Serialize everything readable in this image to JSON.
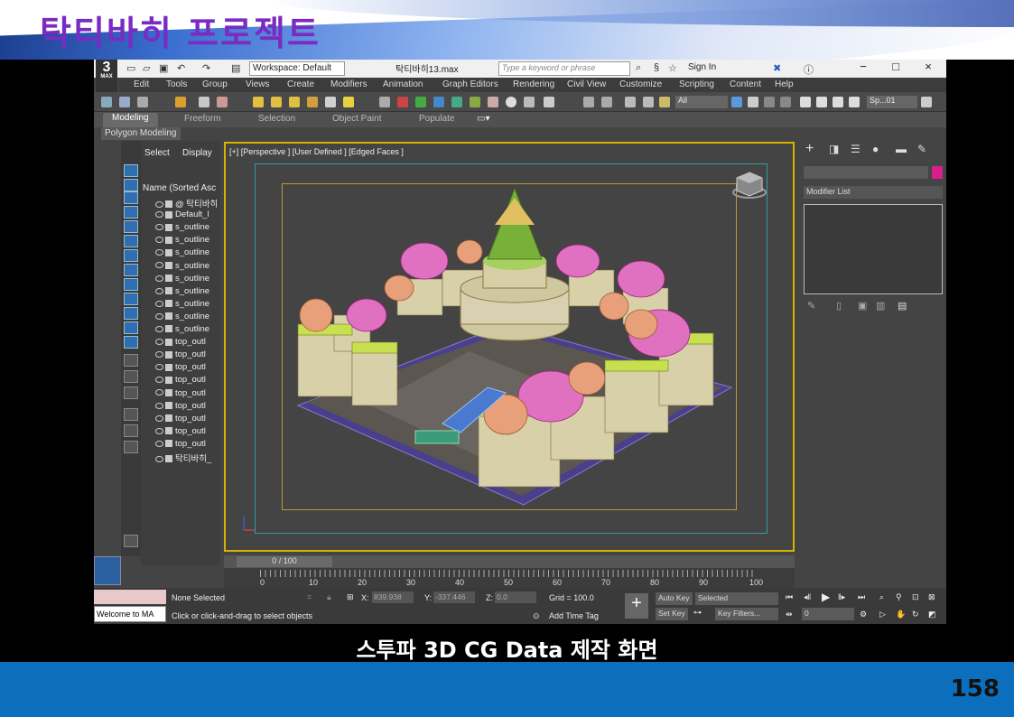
{
  "slide": {
    "title": "탁티바히 프로젝트",
    "caption": "스투파 3D CG Data 제작 화면",
    "page_number": "158"
  },
  "titlebar": {
    "logo_number": "3",
    "logo_sub": "MAX",
    "workspace": "Workspace: Default",
    "filename": "탁티바히13.max",
    "search_placeholder": "Type a keyword or phrase",
    "sign_in": "Sign In"
  },
  "menu": [
    "Edit",
    "Tools",
    "Group",
    "Views",
    "Create",
    "Modifiers",
    "Animation",
    "Graph Editors",
    "Rendering",
    "Civil View",
    "Customize",
    "Scripting",
    "Content",
    "Help"
  ],
  "toolbar": {
    "selection_filter": "All",
    "named_set": "Sp...01"
  },
  "ribbon": {
    "tabs": [
      "Modeling",
      "Freeform",
      "Selection",
      "Object Paint",
      "Populate"
    ],
    "active_tab": "Modeling",
    "sub_label": "Polygon Modeling"
  },
  "scene_explorer": {
    "tab_select": "Select",
    "tab_display": "Display",
    "column_header": "Name (Sorted Asc",
    "rows": [
      "@ 탁티바히",
      "Default_l",
      "s_outline",
      "s_outline",
      "s_outline",
      "s_outline",
      "s_outline",
      "s_outline",
      "s_outline",
      "s_outline",
      "s_outline",
      "top_outl",
      "top_outl",
      "top_outl",
      "top_outl",
      "top_outl",
      "top_outl",
      "top_outl",
      "top_outl",
      "top_outl",
      "탁티바히_"
    ]
  },
  "viewport": {
    "label": "[+] [Perspective ] [User Defined ] [Edged Faces ]"
  },
  "command_panel": {
    "modifier_list": "Modifier List"
  },
  "timeline": {
    "frame": "0 / 100",
    "ticks": [
      "10",
      "20",
      "30",
      "40",
      "50",
      "60",
      "70",
      "80",
      "90",
      "100"
    ],
    "tick_zero": "0"
  },
  "status": {
    "maxscript": "Welcome to MA",
    "selection": "None Selected",
    "prompt": "Click or click-and-drag to select objects",
    "x_label": "X:",
    "x_value": "839.938",
    "y_label": "Y:",
    "y_value": "-337.446",
    "z_label": "Z:",
    "z_value": "0.0",
    "grid": "Grid = 100.0",
    "add_time_tag": "Add Time Tag",
    "auto_key": "Auto Key",
    "selected": "Selected",
    "set_key": "Set Key",
    "key_filters": "Key Filters...",
    "frame_field": "0"
  }
}
